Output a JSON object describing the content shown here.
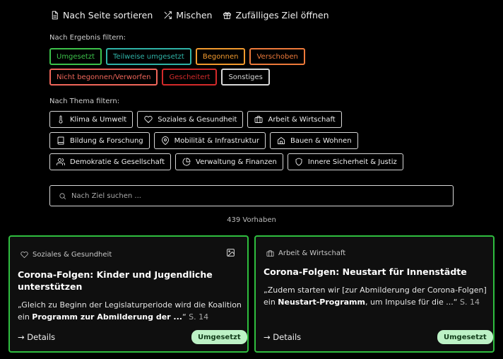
{
  "toolbar": {
    "sort_label": "Nach Seite sortieren",
    "shuffle_label": "Mischen",
    "random_label": "Zufälliges Ziel öffnen"
  },
  "result_filter": {
    "label": "Nach Ergebnis filtern:",
    "chips": [
      {
        "label": "Umgesetzt",
        "color": "#3cc14a"
      },
      {
        "label": "Teilweise umgesetzt",
        "color": "#2fb3a7"
      },
      {
        "label": "Begonnen",
        "color": "#f29a2e"
      },
      {
        "label": "Verschoben",
        "color": "#ee7a3a"
      },
      {
        "label": "Nicht begonnen/Verworfen",
        "color": "#f0665a"
      },
      {
        "label": "Gescheitert",
        "color": "#d42a2a"
      },
      {
        "label": "Sonstiges",
        "color": "#d8d8d8"
      }
    ]
  },
  "topic_filter": {
    "label": "Nach Thema filtern:",
    "chips": [
      {
        "label": "Klima & Umwelt",
        "icon": "thermometer-icon"
      },
      {
        "label": "Soziales & Gesundheit",
        "icon": "heart-icon"
      },
      {
        "label": "Arbeit & Wirtschaft",
        "icon": "briefcase-icon"
      },
      {
        "label": "Bildung & Forschung",
        "icon": "book-icon"
      },
      {
        "label": "Mobilität & Infrastruktur",
        "icon": "map-pin-icon"
      },
      {
        "label": "Bauen & Wohnen",
        "icon": "home-icon"
      },
      {
        "label": "Demokratie & Gesellschaft",
        "icon": "users-icon"
      },
      {
        "label": "Verwaltung & Finanzen",
        "icon": "pie-chart-icon"
      },
      {
        "label": "Innere Sicherheit & Justiz",
        "icon": "shield-icon"
      }
    ]
  },
  "search": {
    "placeholder": "Nach Ziel suchen ..."
  },
  "count_text": "439 Vorhaben",
  "cards": [
    {
      "topic": "Soziales & Gesundheit",
      "title": "Corona-Folgen: Kinder und Jugendliche unterstützen",
      "quote_pre": "„Gleich zu Beginn der Legislaturperiode wird die Koalition ein ",
      "quote_bold": "Programm zur Abmilderung der ...",
      "quote_post": "“",
      "page": "S. 14",
      "details": "→ Details",
      "status": "Umgesetzt"
    },
    {
      "topic": "Arbeit & Wirtschaft",
      "title": "Corona-Folgen: Neustart für Innenstädte",
      "quote_pre": "„Zudem starten wir [zur Abmilderung der Corona-Folgen] ein ",
      "quote_bold": "Neustart-Programm",
      "quote_post": ", um Impulse für die ...“",
      "page": "S. 14",
      "details": "→ Details",
      "status": "Umgesetzt"
    }
  ]
}
